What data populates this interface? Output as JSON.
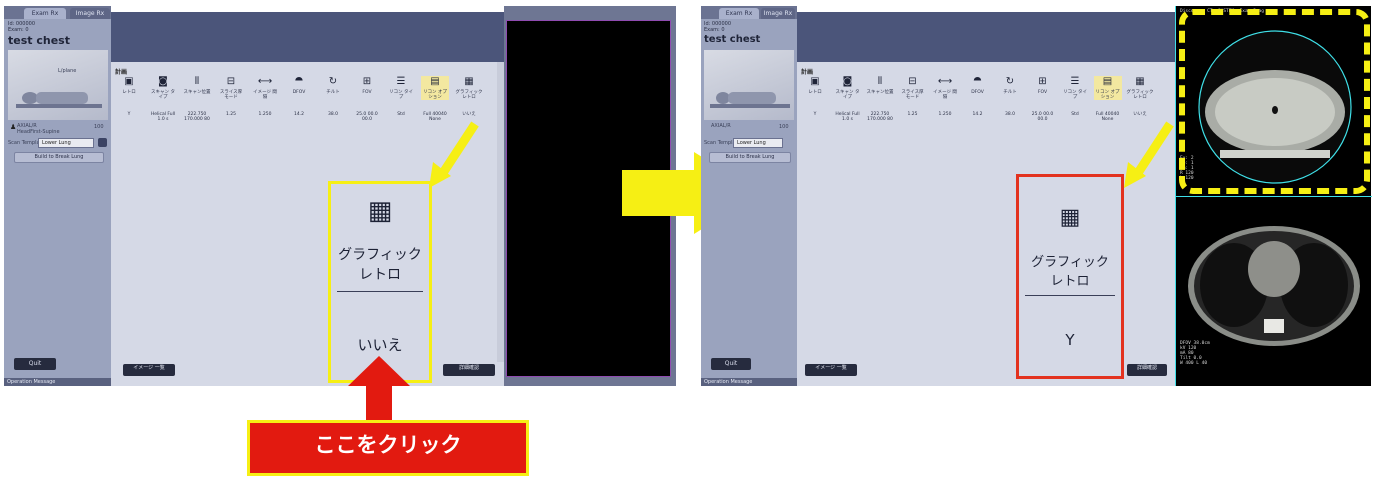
{
  "left": {
    "tabs": [
      "Exam Rx",
      "Image Rx"
    ],
    "patient_small": [
      "Id: 000000",
      "Exam: 0"
    ],
    "patient_name": "test chest",
    "body_label": "L/plane",
    "row_label": "AXIAL/R",
    "row_value": "100",
    "row_sub": "HeadFirst-Supine",
    "scan_label": "Scan Template",
    "scan_value": "Lower Lung",
    "build_button": "Build to Break Lung",
    "quit_button": "Quit",
    "status": "Operation Message"
  },
  "dialog": {
    "plan_title": "計画",
    "tools": [
      {
        "icon": "retro-icon",
        "glyph": "▣",
        "label": "レトロ"
      },
      {
        "icon": "scan-type-icon",
        "glyph": "◙",
        "label": "スキャン タイプ"
      },
      {
        "icon": "scan-position-icon",
        "glyph": "⫴",
        "label": "スキャン位置"
      },
      {
        "icon": "slice-thickness-icon",
        "glyph": "⊟",
        "label": "スライス厚 モード"
      },
      {
        "icon": "image-interval-icon",
        "glyph": "⟷",
        "label": "イメージ 間隔"
      },
      {
        "icon": "dfov-icon",
        "glyph": "⯊",
        "label": "DFOV"
      },
      {
        "icon": "tilt-icon",
        "glyph": "↻",
        "label": "チルト"
      },
      {
        "icon": "fov-icon",
        "glyph": "⊞",
        "label": "FOV"
      },
      {
        "icon": "recon-type-icon",
        "glyph": "☰",
        "label": "リコン タイプ"
      },
      {
        "icon": "recon-option-icon",
        "glyph": "▤",
        "label": "リコン オプション"
      },
      {
        "icon": "graphic-retro-icon",
        "glyph": "▦",
        "label": "グラフィック レトロ"
      }
    ],
    "values_before": [
      "Y",
      "Helical Full 1.0 s",
      "222.750 170.000 80",
      "1.25",
      "1.250",
      "14.2",
      "38.0",
      "25.0 00.0 00.0",
      "Std",
      "Full 40040 None",
      "いいえ"
    ],
    "values_after": [
      "Y",
      "Helical Full 1.0 s",
      "222.750 170.000 80",
      "1.25",
      "1.250",
      "14.2",
      "38.0",
      "25.0 00.0 00.0",
      "Std",
      "Full 40040 None",
      "いいえ"
    ],
    "footer_left": "イメージ 一覧",
    "footer_right": "詳細確認"
  },
  "zoom_before": {
    "icon": "graphic-retro-icon",
    "label_line1": "グラフィック",
    "label_line2": "レトロ",
    "value": "いいえ"
  },
  "zoom_after": {
    "icon": "graphic-retro-icon",
    "label_line1": "グラフィック",
    "label_line2": "レトロ",
    "value": "Y"
  },
  "instruction": "ここをクリック",
  "ct_header": "Discovery CT  SYSTEM  Exam Imag",
  "ct_sub": "Ex: 2\nSe: 1\nIm: 1\nR 120\nL 120",
  "ct_footer": "DFOV 38.0cm\nkV 120\nmA 80\nTilt 0.0\nW 400 L 40",
  "colors": {
    "highlight_yellow": "#f6ef14",
    "click_red": "#e21a10",
    "result_red": "#e3321f",
    "ct_accent": "#3fe0e8"
  }
}
